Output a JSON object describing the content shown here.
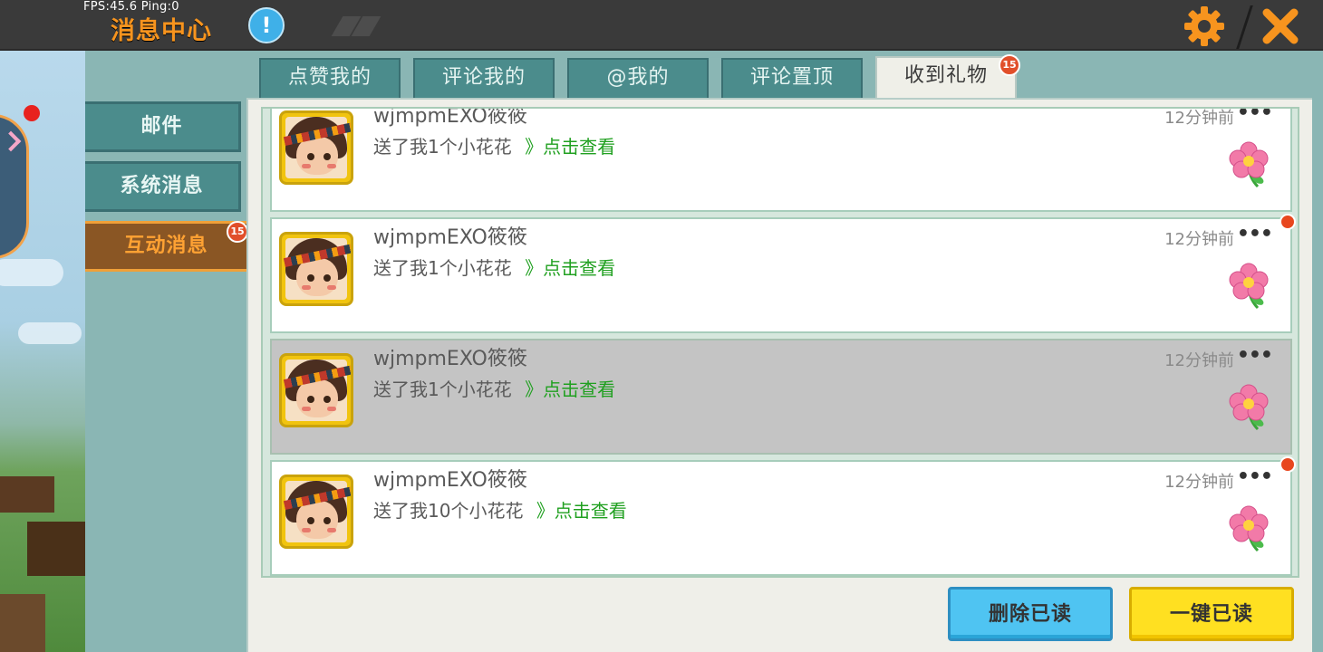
{
  "app": {
    "fps_text": "FPS:45.6  Ping:0",
    "title": "消息中心",
    "help_label": "!"
  },
  "colors": {
    "accent_orange": "#f7941e",
    "tab_teal": "#4b8c8c",
    "link_green": "#20a020",
    "badge_red": "#e14f2a",
    "delete_blue": "#4fc4f2",
    "readall_yellow": "#ffe021"
  },
  "sidebar": {
    "items": [
      {
        "label": "邮件",
        "active": false
      },
      {
        "label": "系统消息",
        "active": false
      },
      {
        "label": "互动消息",
        "active": true,
        "badge": "15"
      }
    ]
  },
  "tabs": [
    {
      "label": "点赞我的",
      "active": false
    },
    {
      "label": "评论我的",
      "active": false
    },
    {
      "label": "@我的",
      "active": false
    },
    {
      "label": "评论置顶",
      "active": false
    },
    {
      "label": "收到礼物",
      "active": true,
      "badge": "15"
    }
  ],
  "messages": [
    {
      "username": "wjmpmEXO筱筱",
      "text": "送了我1个小花花",
      "link": "》点击查看",
      "time": "12分钟前",
      "more": "•••",
      "unread": false,
      "selected": false,
      "icon": "flower-icon"
    },
    {
      "username": "wjmpmEXO筱筱",
      "text": "送了我1个小花花",
      "link": "》点击查看",
      "time": "12分钟前",
      "more": "•••",
      "unread": true,
      "selected": false,
      "icon": "flower-icon"
    },
    {
      "username": "wjmpmEXO筱筱",
      "text": "送了我1个小花花",
      "link": "》点击查看",
      "time": "12分钟前",
      "more": "•••",
      "unread": false,
      "selected": true,
      "icon": "flower-icon"
    },
    {
      "username": "wjmpmEXO筱筱",
      "text": "送了我10个小花花",
      "link": "》点击查看",
      "time": "12分钟前",
      "more": "•••",
      "unread": true,
      "selected": false,
      "icon": "flower-icon"
    }
  ],
  "actions": {
    "delete_read": "删除已读",
    "mark_all_read": "一键已读"
  }
}
